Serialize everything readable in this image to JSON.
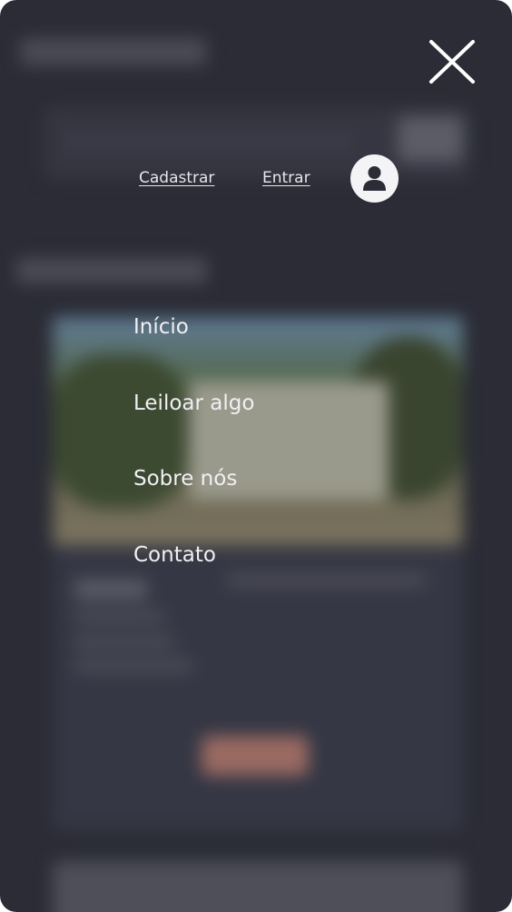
{
  "header": {
    "close_icon": "close-icon"
  },
  "auth": {
    "register_label": "Cadastrar",
    "login_label": "Entrar",
    "avatar_icon": "user-icon"
  },
  "menu": {
    "items": [
      {
        "label": "Início"
      },
      {
        "label": "Leiloar algo"
      },
      {
        "label": "Sobre nós"
      },
      {
        "label": "Contato"
      }
    ]
  },
  "colors": {
    "background": "#2b2c36",
    "menu_text": "#f0f0f3",
    "avatar_bg": "#f4f4f6"
  }
}
